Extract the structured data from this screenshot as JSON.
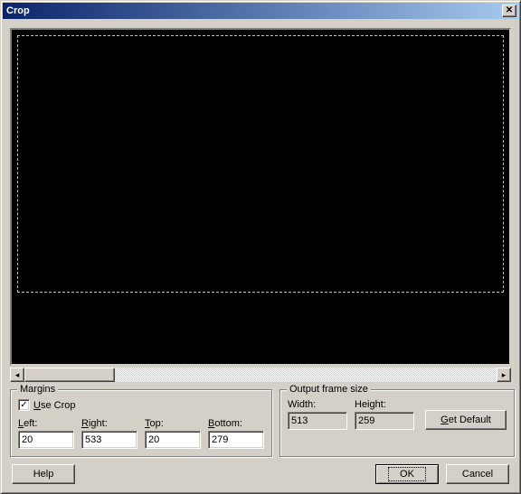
{
  "window": {
    "title": "Crop"
  },
  "margins": {
    "legend": "Margins",
    "use_crop_label": "Use Crop",
    "use_crop_checked": true,
    "left_label": "Left:",
    "right_label": "Right:",
    "top_label": "Top:",
    "bottom_label": "Bottom:",
    "left": "20",
    "right": "533",
    "top": "20",
    "bottom": "279"
  },
  "output": {
    "legend": "Output frame size",
    "width_label": "Width:",
    "height_label": "Height:",
    "width": "513",
    "height": "259",
    "get_default": "Get Default"
  },
  "buttons": {
    "help": "Help",
    "ok": "OK",
    "cancel": "Cancel"
  },
  "hotkeys": {
    "use_crop_u": "U",
    "left_u": "L",
    "right_u": "R",
    "top_u": "T",
    "bottom_u": "B",
    "get_default_u": "G"
  }
}
